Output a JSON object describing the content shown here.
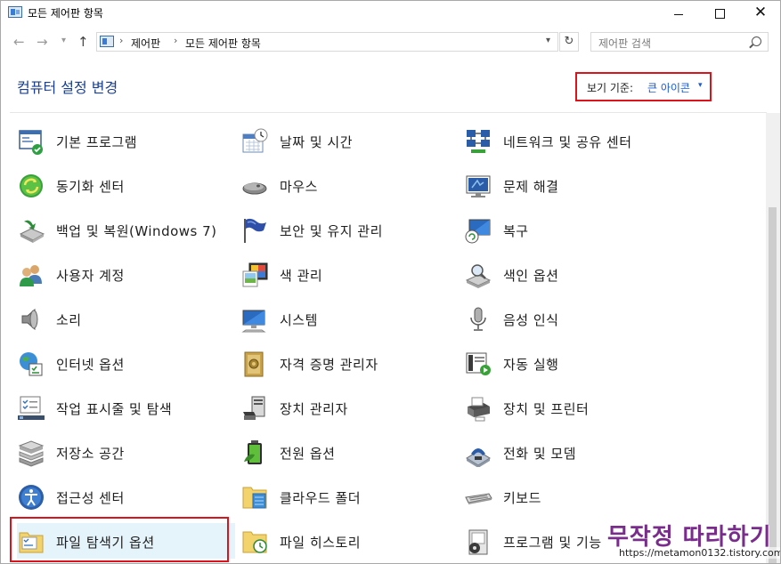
{
  "window": {
    "title": "모든 제어판 항목",
    "controls": {
      "minimize": "—",
      "maximize": "☐",
      "close": "✕"
    }
  },
  "nav": {
    "back": "←",
    "forward": "→",
    "recent": "⌄",
    "up": "↑",
    "breadcrumb": [
      "제어판",
      "모든 제어판 항목"
    ],
    "separator": "›",
    "refresh": "↻"
  },
  "search": {
    "placeholder": "제어판 검색"
  },
  "header": {
    "title": "컴퓨터 설정 변경",
    "view_by_label": "보기 기준:",
    "view_by_value": "큰 아이콘",
    "view_by_arrow": "▾"
  },
  "items": [
    {
      "label": "기본 프로그램",
      "icon": "default-programs-icon"
    },
    {
      "label": "날짜 및 시간",
      "icon": "calendar-clock-icon"
    },
    {
      "label": "네트워크 및 공유 센터",
      "icon": "network-icon"
    },
    {
      "label": "동기화 센터",
      "icon": "sync-icon"
    },
    {
      "label": "마우스",
      "icon": "mouse-icon"
    },
    {
      "label": "문제 해결",
      "icon": "troubleshoot-icon"
    },
    {
      "label": "백업 및 복원(Windows 7)",
      "icon": "backup-icon"
    },
    {
      "label": "보안 및 유지 관리",
      "icon": "flag-icon"
    },
    {
      "label": "복구",
      "icon": "recovery-icon"
    },
    {
      "label": "사용자 계정",
      "icon": "users-icon"
    },
    {
      "label": "색 관리",
      "icon": "color-management-icon"
    },
    {
      "label": "색인 옵션",
      "icon": "indexing-icon"
    },
    {
      "label": "소리",
      "icon": "speaker-icon"
    },
    {
      "label": "시스템",
      "icon": "system-monitor-icon"
    },
    {
      "label": "음성 인식",
      "icon": "microphone-icon"
    },
    {
      "label": "인터넷 옵션",
      "icon": "internet-options-icon"
    },
    {
      "label": "자격 증명 관리자",
      "icon": "credential-vault-icon"
    },
    {
      "label": "자동 실행",
      "icon": "autoplay-icon"
    },
    {
      "label": "작업 표시줄 및 탐색",
      "icon": "taskbar-icon"
    },
    {
      "label": "장치 관리자",
      "icon": "device-manager-icon"
    },
    {
      "label": "장치 및 프린터",
      "icon": "printer-icon"
    },
    {
      "label": "저장소 공간",
      "icon": "storage-spaces-icon"
    },
    {
      "label": "전원 옵션",
      "icon": "power-battery-icon"
    },
    {
      "label": "전화 및 모뎀",
      "icon": "phone-modem-icon"
    },
    {
      "label": "접근성 센터",
      "icon": "accessibility-icon"
    },
    {
      "label": "클라우드 폴더",
      "icon": "cloud-folder-icon"
    },
    {
      "label": "키보드",
      "icon": "keyboard-icon"
    },
    {
      "label": "파일 탐색기 옵션",
      "icon": "folder-options-icon"
    },
    {
      "label": "파일 히스토리",
      "icon": "file-history-icon"
    },
    {
      "label": "프로그램 및 기능",
      "icon": "programs-features-icon"
    }
  ],
  "watermark": {
    "text": "무작정 따라하기",
    "url": "https://metamon0132.tistory.com/"
  },
  "colors": {
    "title_blue": "#1a3e8c",
    "link_blue": "#1a5ad9",
    "highlight_red": "#d9141c",
    "watermark_purple": "#7a2c8c"
  }
}
